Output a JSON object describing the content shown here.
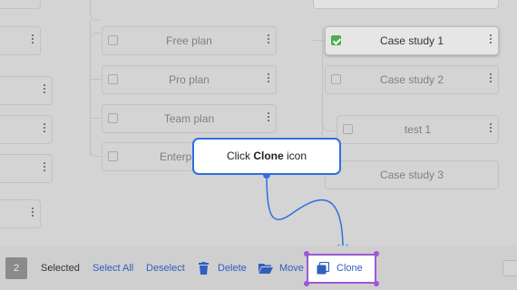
{
  "flow": {
    "column2": {
      "cards": [
        {
          "label": "Free plan"
        },
        {
          "label": "Pro plan"
        },
        {
          "label": "Team plan"
        },
        {
          "label": "Enterpri"
        }
      ]
    },
    "column3": {
      "cards": [
        {
          "label": "Case study 1",
          "checked": true
        },
        {
          "label": "Case study 2"
        },
        {
          "label": "test 1"
        },
        {
          "label": "Case study 3"
        }
      ]
    }
  },
  "tooltip": {
    "prefix": "Click",
    "bold": "Clone",
    "suffix": "icon"
  },
  "toolbar": {
    "selected_count": "2",
    "selected_label": "Selected",
    "select_all": "Select All",
    "deselect": "Deselect",
    "delete": "Delete",
    "move": "Move",
    "clone": "Clone"
  },
  "icons": {
    "delete": "trash-icon",
    "move": "folder-icon",
    "clone": "copy-icon"
  },
  "colors": {
    "accent": "#2f6fe0",
    "highlight": "#9b59d6",
    "check": "#4caf50",
    "link": "#2f5fbf"
  }
}
